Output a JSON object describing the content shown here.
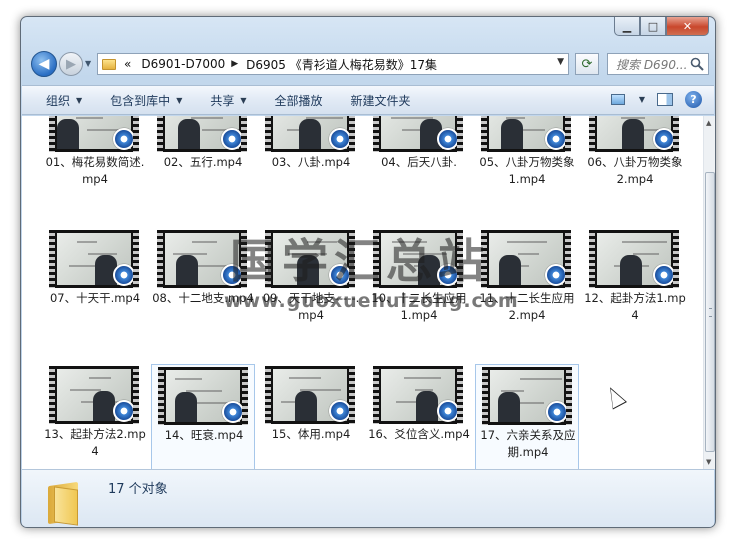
{
  "window": {
    "caption": {
      "minimize": "▁",
      "maximize": "□",
      "close": "✕"
    }
  },
  "nav": {
    "back": "◀",
    "forward": "▶",
    "history": "▼",
    "breadcrumb": {
      "overflow": "«",
      "sep": "▶",
      "parent": "D6901-D7000",
      "current": "D6905 《青衫道人梅花易数》17集"
    },
    "address_dropdown": "▼",
    "refresh": "⟳",
    "search_placeholder": "搜索 D690..."
  },
  "toolbar": {
    "organize": "组织",
    "include_in_library": "包含到库中",
    "share": "共享",
    "play_all": "全部播放",
    "new_folder": "新建文件夹",
    "arrow": "▼",
    "help": "?"
  },
  "files": [
    {
      "name": "01、梅花易数简述.mp4"
    },
    {
      "name": "02、五行.mp4"
    },
    {
      "name": "03、八卦.mp4"
    },
    {
      "name": "04、后天八卦."
    },
    {
      "name": "05、八卦万物类象1.mp4"
    },
    {
      "name": "06、八卦万物类象2.mp4"
    },
    {
      "name": "07、十天干.mp4"
    },
    {
      "name": "08、十二地支.mp4"
    },
    {
      "name": "09、天干地支-----.mp4"
    },
    {
      "name": "10、十二长生应用1.mp4"
    },
    {
      "name": "11、十二长生应用2.mp4"
    },
    {
      "name": "12、起卦方法1.mp4"
    },
    {
      "name": "13、起卦方法2.mp4"
    },
    {
      "name": "14、旺衰.mp4"
    },
    {
      "name": "15、体用.mp4"
    },
    {
      "name": "16、爻位含义.mp4"
    },
    {
      "name": "17、六亲关系及应期.mp4"
    }
  ],
  "watermark": {
    "title": "国学汇总站",
    "url": "www.guoxuehuizong.com"
  },
  "details": {
    "count": "17 个对象"
  },
  "scrollbar": {
    "up": "▲",
    "down": "▼"
  }
}
